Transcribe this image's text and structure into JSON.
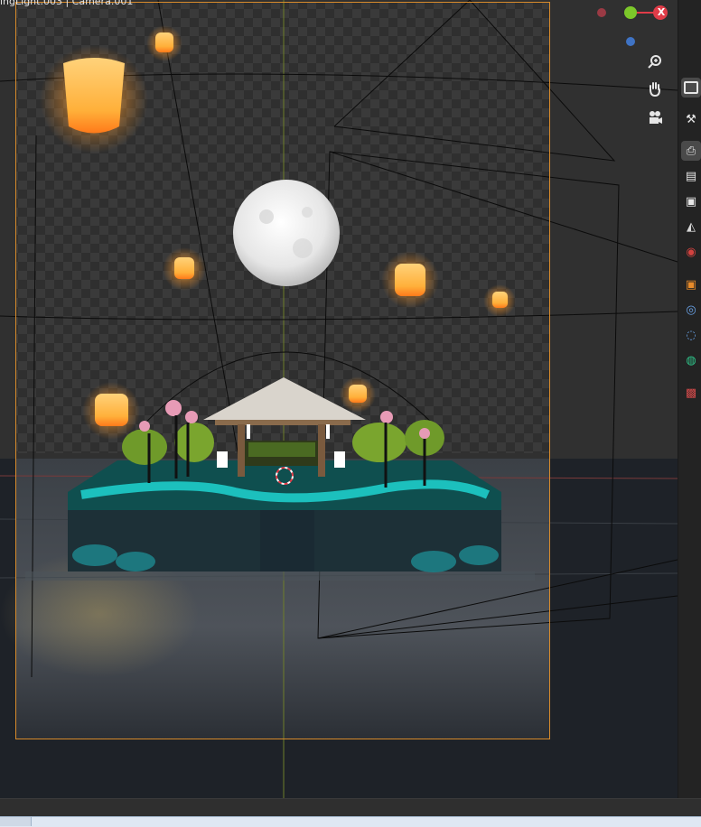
{
  "viewport": {
    "overlay_text": "ingLight.003 | Camera.001"
  },
  "gizmo": {
    "x_axis_label": "X",
    "colors": {
      "x": "#e03c48",
      "y": "#7cc82a",
      "z": "#3f73c4"
    }
  },
  "navigation": {
    "icons": [
      "zoom-icon",
      "pan-hand-icon",
      "camera-view-icon"
    ]
  },
  "properties_tabs": {
    "icons": [
      "tool-icon",
      "render-icon",
      "output-icon",
      "view-layer-icon",
      "scene-icon",
      "world-icon",
      "object-icon",
      "modifier-icon",
      "particles-icon",
      "physics-icon",
      "texture-icon"
    ]
  },
  "colors": {
    "camera_frame": "#d88b2b",
    "lantern_glow": "#ffb43a",
    "water_teal": "#1fd3d0"
  }
}
